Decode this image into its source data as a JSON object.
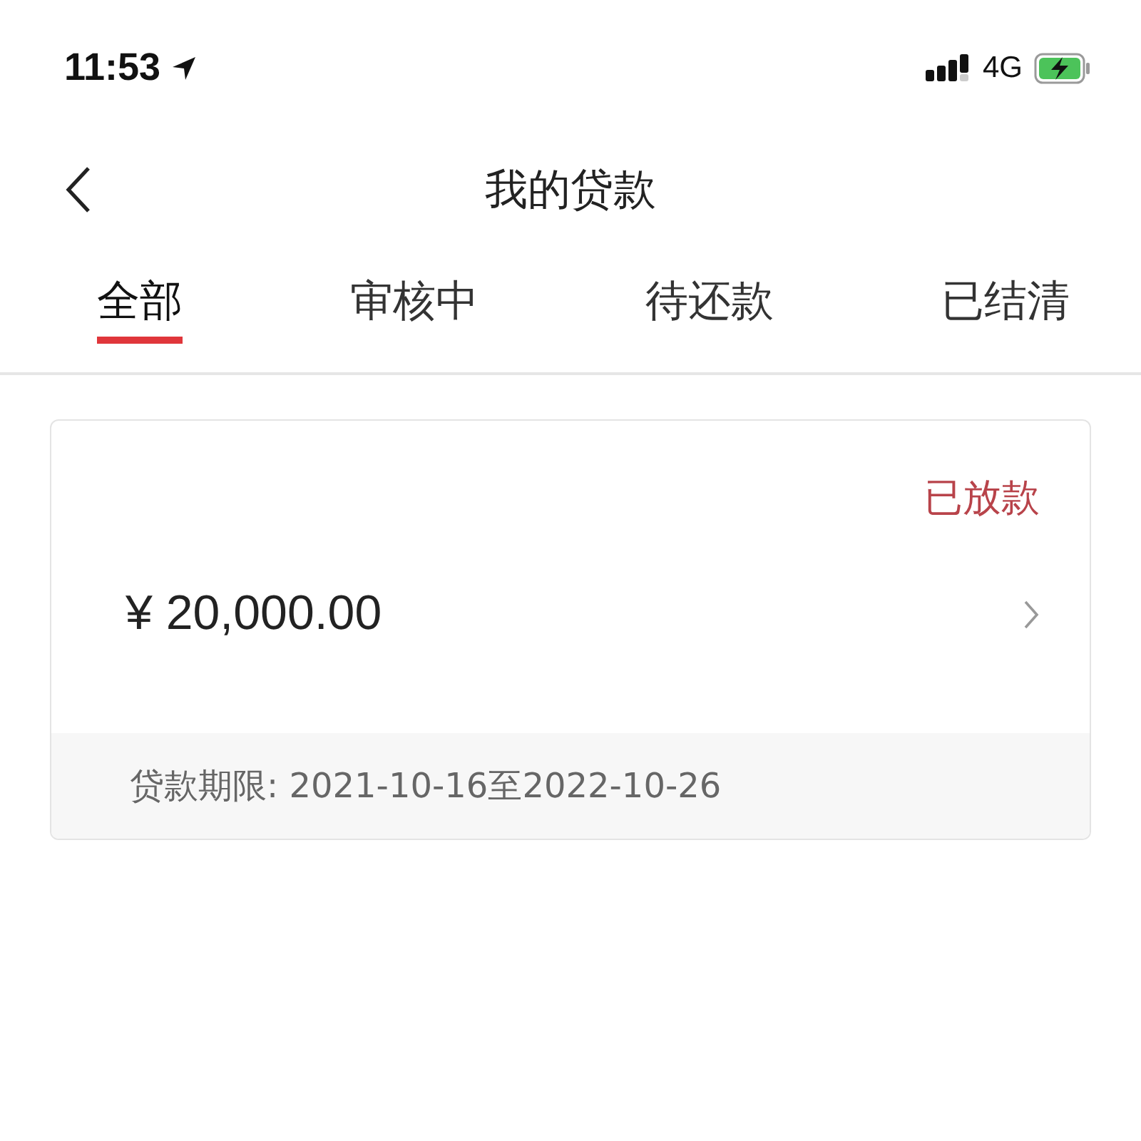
{
  "status_bar": {
    "time": "11:53",
    "network": "4G"
  },
  "nav": {
    "title": "我的贷款"
  },
  "tabs": [
    {
      "label": "全部",
      "selected": true
    },
    {
      "label": "审核中",
      "selected": false
    },
    {
      "label": "待还款",
      "selected": false
    },
    {
      "label": "已结清",
      "selected": false
    }
  ],
  "loans": [
    {
      "status": "已放款",
      "amount": "¥ 20,000.00",
      "term": "贷款期限: 2021-10-16至2022-10-26"
    }
  ]
}
